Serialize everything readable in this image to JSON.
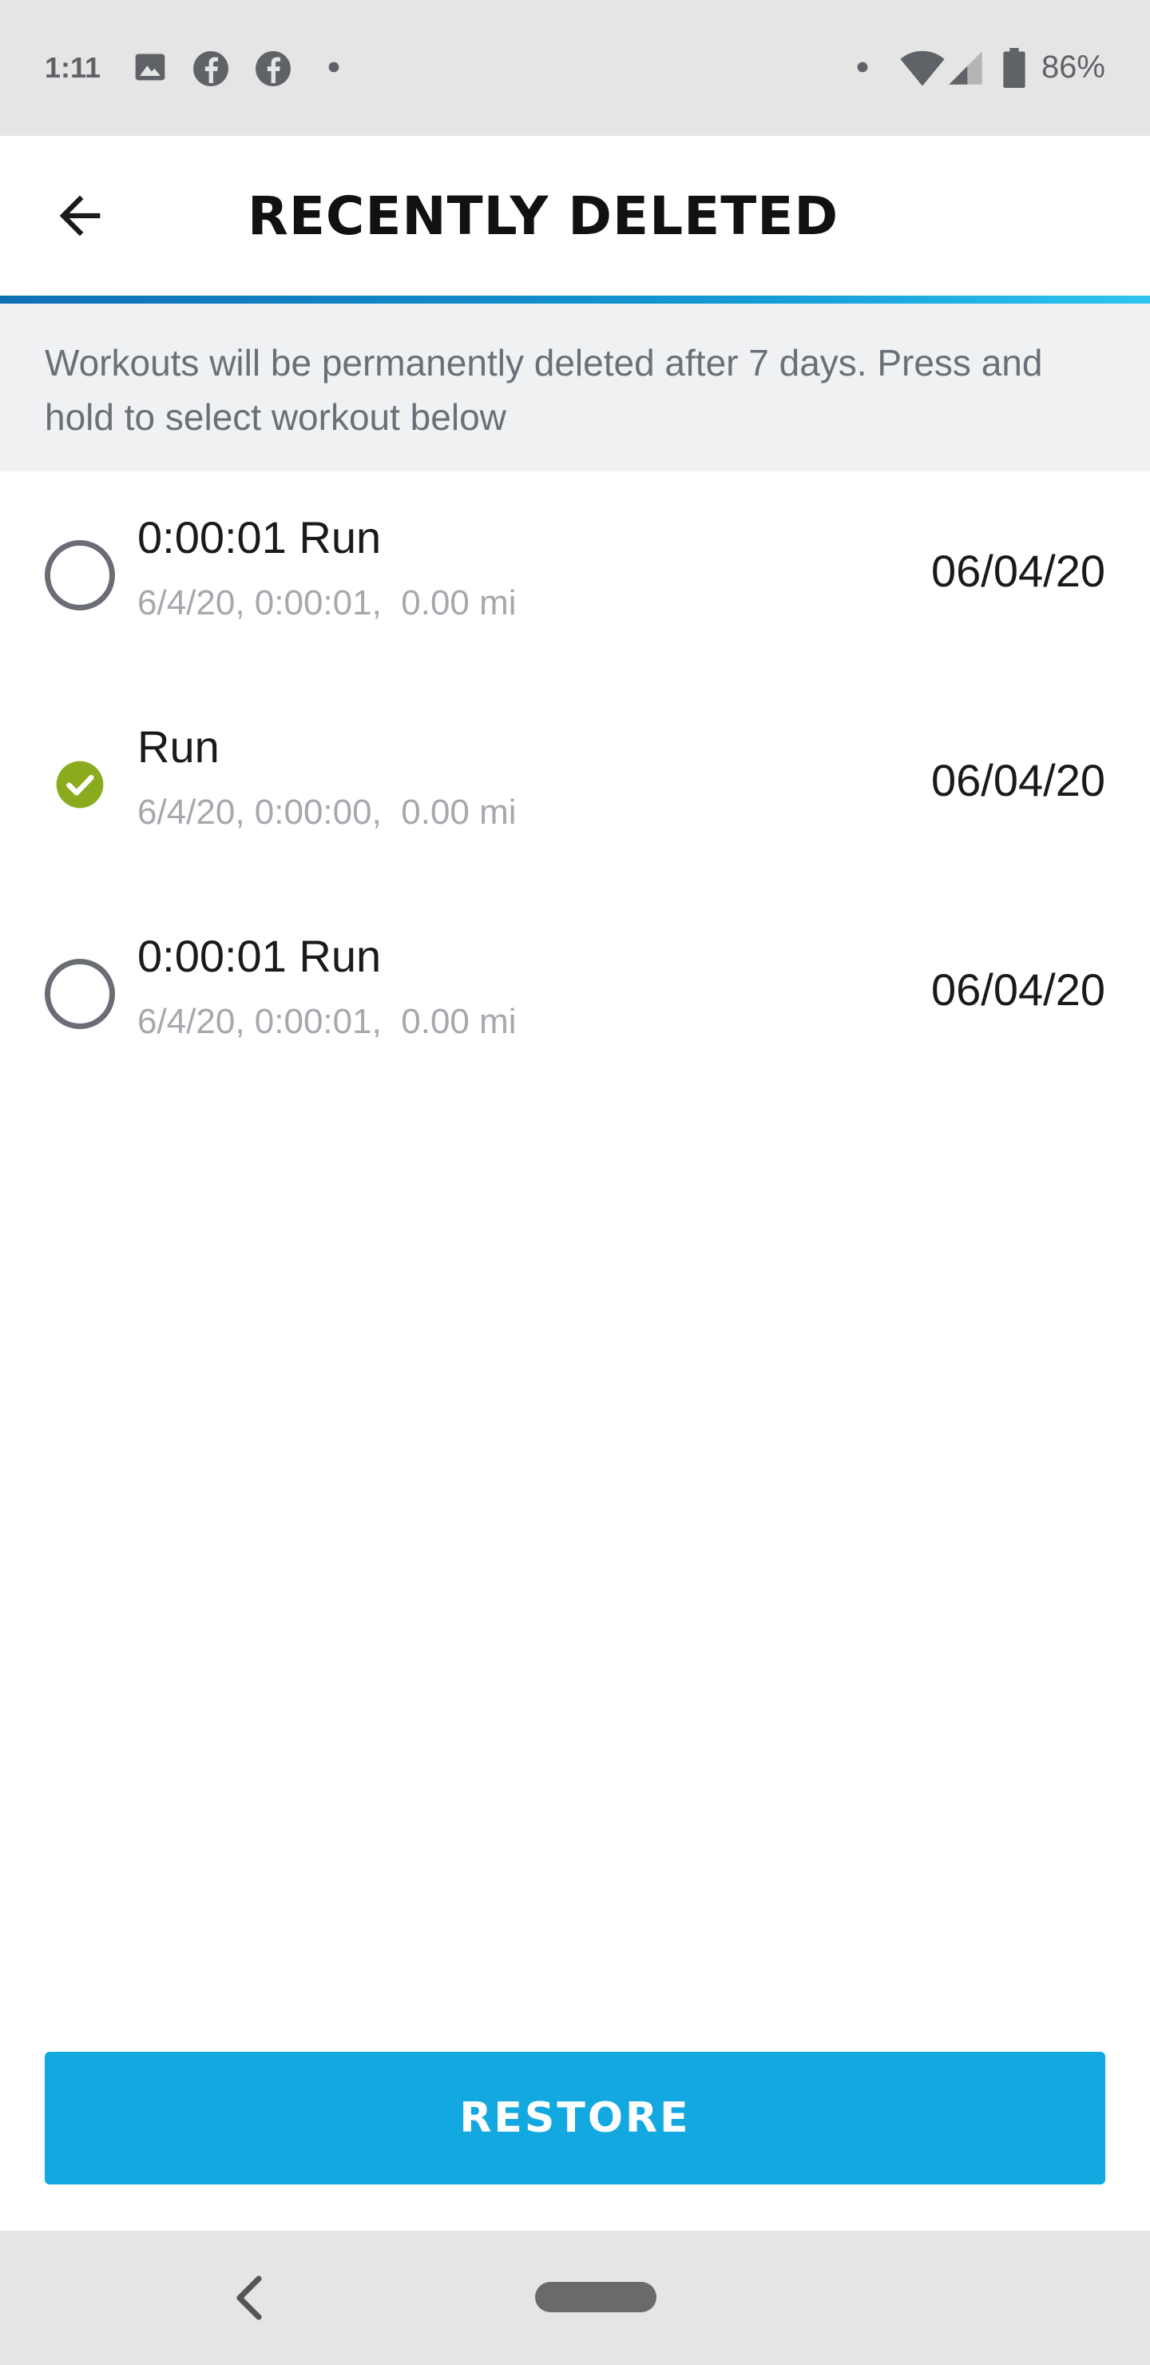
{
  "status_bar": {
    "time": "1:11",
    "battery": "86%",
    "icons": [
      "image-icon",
      "facebook-icon",
      "facebook-icon",
      "dot-icon",
      "dot-icon",
      "wifi-icon",
      "signal-icon",
      "battery-icon"
    ]
  },
  "header": {
    "title": "RECENTLY DELETED",
    "back_icon": "arrow-left-icon"
  },
  "info": {
    "text": "Workouts will be permanently deleted after 7 days. Press and hold to select workout below"
  },
  "workouts": [
    {
      "title": "0:00:01 Run",
      "subtitle": "6/4/20, 0:00:01,  0.00 mi",
      "date": "06/04/20",
      "selected": false
    },
    {
      "title": "Run",
      "subtitle": "6/4/20, 0:00:00,  0.00 mi",
      "date": "06/04/20",
      "selected": true
    },
    {
      "title": "0:00:01 Run",
      "subtitle": "6/4/20, 0:00:01,  0.00 mi",
      "date": "06/04/20",
      "selected": false
    }
  ],
  "restore_button": {
    "label": "RESTORE"
  },
  "colors": {
    "accent": "#14a8e1",
    "check": "#8aab1e",
    "header_rule": "#0f6fb4"
  }
}
